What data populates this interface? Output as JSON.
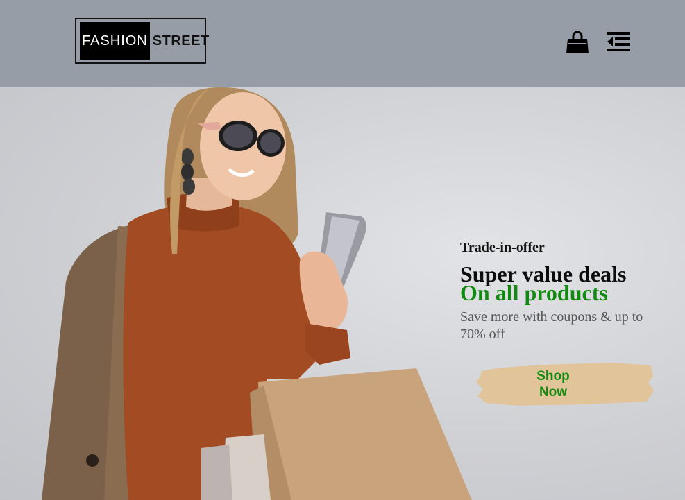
{
  "header": {
    "logo_part1": "FASHION",
    "logo_part2": "STREET",
    "cart_icon": "shopping-bag-icon",
    "menu_icon": "menu-indent-icon",
    "background": "#969da6"
  },
  "hero": {
    "subtitle": "Trade-in-offer",
    "title": "Super value deals",
    "title_accent": "On all products",
    "description": "Save more with coupons & up to 70% off",
    "shop_button_label": "Shop Now",
    "accent_color": "#128a12",
    "button_color": "#e2c49a"
  }
}
